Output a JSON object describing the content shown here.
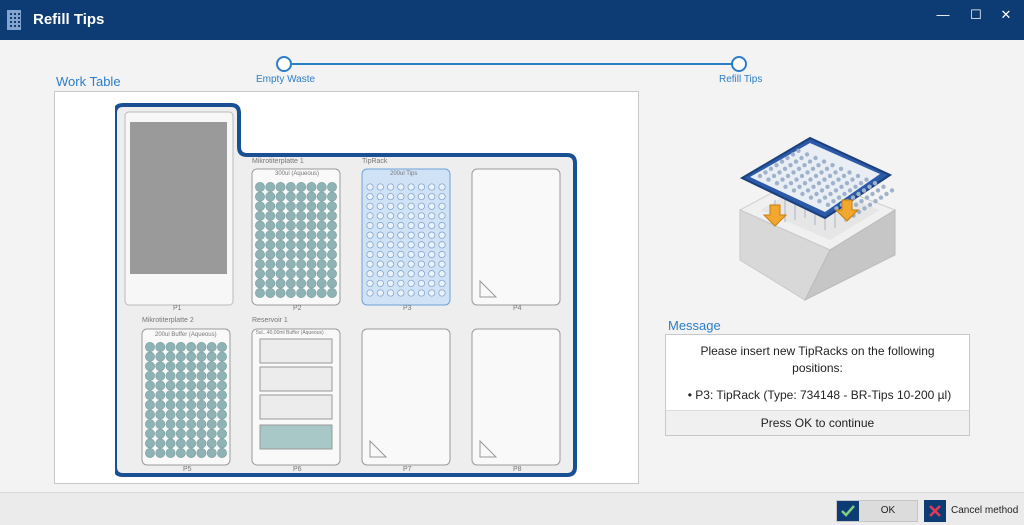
{
  "window": {
    "title": "Refill Tips",
    "controls": {
      "minimize": "—",
      "maximize": "☐",
      "close": "✕"
    }
  },
  "stepper": {
    "steps": [
      {
        "label": "Empty Waste"
      },
      {
        "label": "Refill Tips"
      }
    ]
  },
  "work_table": {
    "label": "Work Table",
    "positions": [
      {
        "id": "P1",
        "title": "",
        "content_label": ""
      },
      {
        "id": "P2",
        "title": "Mikrotiterplatte 1",
        "content_label": "300ul (Aqueous)"
      },
      {
        "id": "P3",
        "title": "TipRack",
        "content_label": "200ul Tips",
        "highlight": true
      },
      {
        "id": "P4",
        "title": "",
        "content_label": ""
      },
      {
        "id": "P5",
        "title": "Mikrotiterplatte 2",
        "content_label": "200ul Buffer (Aqueous)"
      },
      {
        "id": "P6",
        "title": "Reservoir 1",
        "content_label": "5ul...40,00ml Buffer (Aqueous)"
      },
      {
        "id": "P7",
        "title": "",
        "content_label": ""
      },
      {
        "id": "P8",
        "title": "",
        "content_label": ""
      }
    ]
  },
  "message": {
    "label": "Message",
    "text": "Please insert new TipRacks on the following positions:",
    "items": [
      "• P3: TipRack (Type: 734148 - BR-Tips 10-200 µl)"
    ],
    "footer": "Press OK to continue"
  },
  "buttons": {
    "ok": "OK",
    "cancel": "Cancel method"
  },
  "colors": {
    "titlebar": "#0d3b73",
    "accent": "#2b7ec9",
    "deck_border": "#1b4f93",
    "well": "#8fb3b5",
    "tip_highlight": "#cfe2f6"
  }
}
